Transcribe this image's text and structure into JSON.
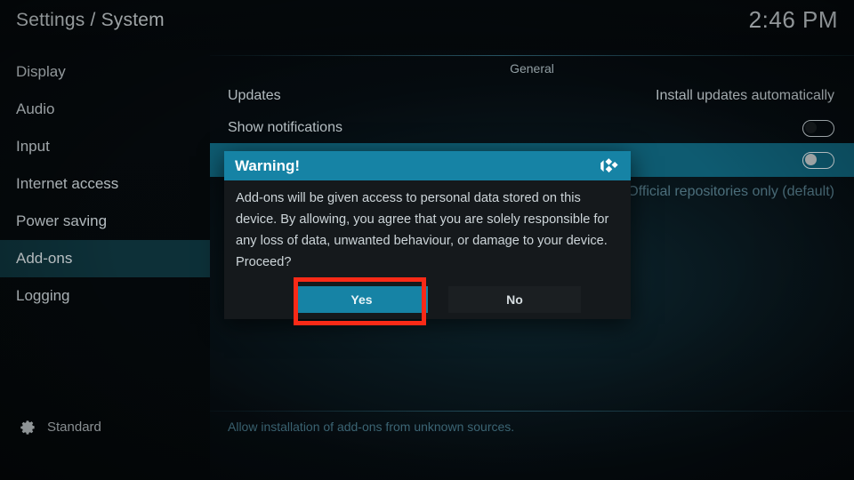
{
  "header": {
    "title": "Settings / System",
    "clock": "2:46 PM"
  },
  "sidebar": {
    "items": [
      {
        "label": "Display",
        "selected": false
      },
      {
        "label": "Audio",
        "selected": false
      },
      {
        "label": "Input",
        "selected": false
      },
      {
        "label": "Internet access",
        "selected": false
      },
      {
        "label": "Power saving",
        "selected": false
      },
      {
        "label": "Add-ons",
        "selected": true
      },
      {
        "label": "Logging",
        "selected": false
      }
    ],
    "footer": {
      "icon": "gear-icon",
      "label": "Standard"
    }
  },
  "main": {
    "section_header": "General",
    "rows": [
      {
        "label": "Updates",
        "value": "Install updates automatically",
        "control": "text",
        "focused": false,
        "dim": false
      },
      {
        "label": "Show notifications",
        "value": "",
        "control": "toggle",
        "toggle_on": false,
        "focused": false,
        "dim": false
      },
      {
        "label": "",
        "value": "",
        "control": "toggle",
        "toggle_on": false,
        "focused": true,
        "dim": false
      },
      {
        "label": "",
        "value": "Official repositories only (default)",
        "control": "text",
        "focused": false,
        "dim": true
      }
    ],
    "help_text": "Allow installation of add-ons from unknown sources."
  },
  "dialog": {
    "title": "Warning!",
    "logo": "kodi-logo-icon",
    "message": "Add-ons will be given access to personal data stored on this device. By allowing, you agree that you are solely responsible for any loss of data, unwanted behaviour, or damage to your device. Proceed?",
    "buttons": {
      "yes": "Yes",
      "no": "No"
    },
    "focused_button": "Yes"
  },
  "colors": {
    "accent_teal": "#1683a5",
    "focus_row": "#0e5b71",
    "sidebar_selected": "#0d3038",
    "annotation_red": "#f92a17",
    "help_text": "#3f6b7b"
  }
}
